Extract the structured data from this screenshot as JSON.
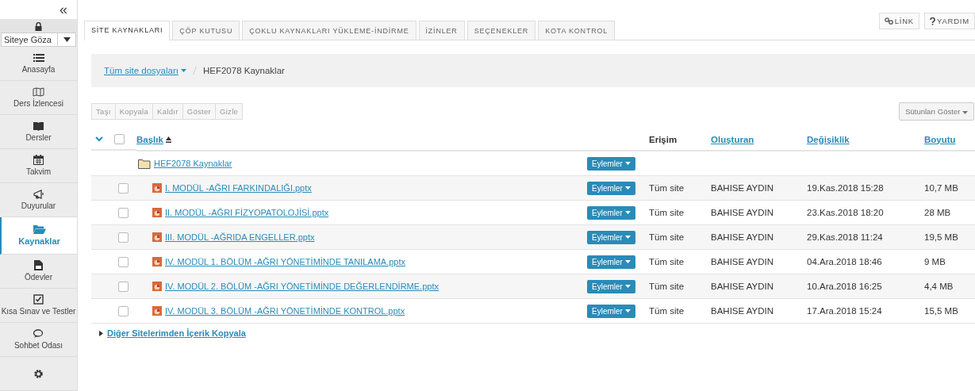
{
  "sidebar": {
    "collapse": "«",
    "site_select": {
      "value": "Siteye Göza"
    },
    "items": [
      {
        "label": "Anasayfa",
        "selected": false
      },
      {
        "label": "Ders İzlencesi",
        "selected": false
      },
      {
        "label": "Dersler",
        "selected": false
      },
      {
        "label": "Takvim",
        "selected": false
      },
      {
        "label": "Duyurular",
        "selected": false
      },
      {
        "label": "Kaynaklar",
        "selected": true
      },
      {
        "label": "Ödevler",
        "selected": false
      },
      {
        "label": "Kısa Sınav ve Testler",
        "selected": false
      },
      {
        "label": "Sohbet Odası",
        "selected": false
      },
      {
        "selected": false
      }
    ]
  },
  "tabs": [
    {
      "label": "SİTE KAYNAKLARI",
      "selected": true
    },
    {
      "label": "ÇÖP KUTUSU",
      "selected": false
    },
    {
      "label": "ÇOKLU KAYNAKLARI YÜKLEME-İNDİRME",
      "selected": false
    },
    {
      "label": "İZİNLER",
      "selected": false
    },
    {
      "label": "SEÇENEKLER",
      "selected": false
    },
    {
      "label": "KOTA KONTROL",
      "selected": false
    }
  ],
  "top_buttons": [
    "LİNK",
    "YARDIM"
  ],
  "breadcrumb": {
    "root": "Tüm site dosyaları",
    "current": "HEF2078 Kaynaklar"
  },
  "toolbar": [
    {
      "label": "Taşı",
      "disabled": true
    },
    {
      "label": "Kopyala",
      "disabled": true
    },
    {
      "label": "Kaldır",
      "disabled": true
    },
    {
      "label": "Göster",
      "disabled": true
    },
    {
      "label": "Gizle",
      "disabled": true
    }
  ],
  "columns_button": "Sütunları Göster",
  "table": {
    "expanded": true,
    "select_all_checked": false,
    "columns": [
      "Başlık",
      "Erişim",
      "Oluşturan",
      "Değişiklik",
      "Boyutu"
    ],
    "rows": [
      {
        "kind": "folder",
        "title": "HEF2078 Kaynaklar",
        "action": "Eylemler"
      },
      {
        "kind": "file",
        "checked": false,
        "title": "I. MODÜL -AĞRI FARKINDALIĞI.pptx",
        "action": "Eylemler",
        "access": "Tüm site",
        "creator": "BAHISE AYDIN",
        "modified": "19.Kas.2018 15:28",
        "size": "10,7 MB"
      },
      {
        "kind": "file",
        "checked": false,
        "title": "II. MODÜL -AĞRI FİZYOPATOLOJİSİ.pptx",
        "action": "Eylemler",
        "access": "Tüm site",
        "creator": "BAHISE AYDIN",
        "modified": "23.Kas.2018 18:20",
        "size": "28 MB"
      },
      {
        "kind": "file",
        "checked": false,
        "title": "III. MODÜL -AĞRIDA ENGELLER.pptx",
        "action": "Eylemler",
        "access": "Tüm site",
        "creator": "BAHISE AYDIN",
        "modified": "29.Kas.2018 11:24",
        "size": "19,5 MB"
      },
      {
        "kind": "file",
        "checked": false,
        "title": "IV. MODÜL 1. BÖLÜM -AĞRI YÖNETİMİNDE TANILAMA.pptx",
        "action": "Eylemler",
        "access": "Tüm site",
        "creator": "BAHISE AYDIN",
        "modified": "04.Ara.2018 18:46",
        "size": "9 MB"
      },
      {
        "kind": "file",
        "checked": false,
        "title": "IV. MODÜL 2. BÖLÜM -AĞRI YÖNETİMİNDE DEĞERLENDİRME.pptx",
        "action": "Eylemler",
        "access": "Tüm site",
        "creator": "BAHISE AYDIN",
        "modified": "10.Ara.2018 16:25",
        "size": "4,4 MB"
      },
      {
        "kind": "file",
        "checked": false,
        "title": "IV. MODÜL 3. BÖLÜM -AĞRI YÖNETİMİNDE KONTROL.pptx",
        "action": "Eylemler",
        "access": "Tüm site",
        "creator": "BAHISE AYDIN",
        "modified": "17.Ara.2018 15:24",
        "size": "15,5 MB"
      }
    ]
  },
  "copy_section": {
    "label": "Diğer Sitelerimden İçerik Kopyala",
    "expanded": false
  }
}
